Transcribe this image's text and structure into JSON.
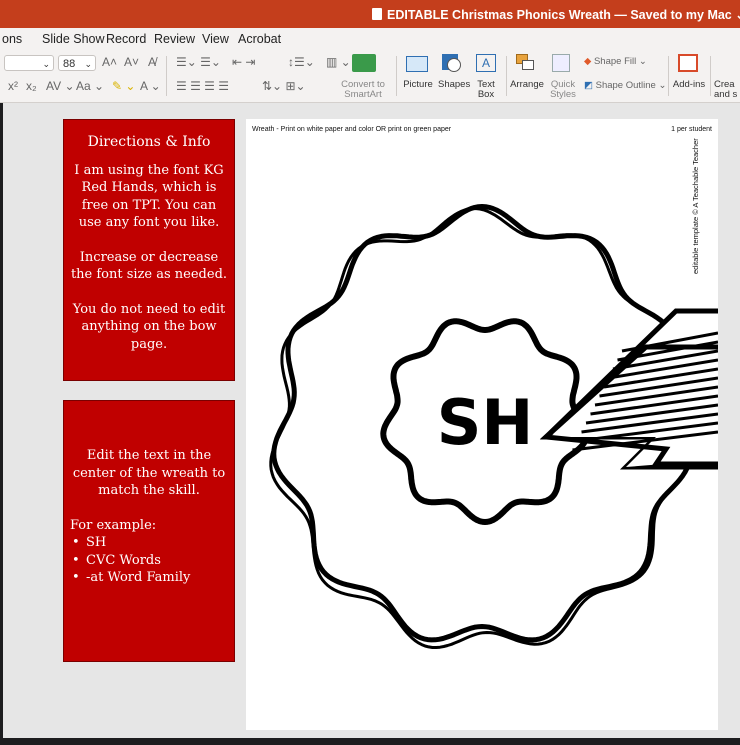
{
  "title_bar": {
    "title": "EDITABLE Christmas Phonics Wreath — Saved to my Mac ⌄"
  },
  "menu": [
    "ons",
    "Slide Show",
    "Record",
    "Review",
    "View",
    "Acrobat"
  ],
  "ribbon": {
    "font_size": "88",
    "convert_to_smartart": [
      "Convert to",
      "SmartArt"
    ],
    "picture": "Picture",
    "shapes": "Shapes",
    "text_box": [
      "Text",
      "Box"
    ],
    "arrange": "Arrange",
    "quick_styles": [
      "Quick",
      "Styles"
    ],
    "shape_fill": "Shape Fill",
    "shape_outline": "Shape Outline",
    "add_ins": "Add-ins",
    "create_share": [
      "Crea",
      "and s"
    ]
  },
  "notes": {
    "directions": {
      "heading": "Directions & Info",
      "p1": "I am using the font KG Red Hands, which is free on TPT. You can use any font you like.",
      "p2": "Increase or decrease the font size as needed.",
      "p3": "You do not need to edit anything on the bow page."
    },
    "edit": {
      "p1": "Edit the text in the center of the wreath to match the skill.",
      "example": "For example:",
      "items": [
        "SH",
        "CVC Words",
        "-at Word Family"
      ]
    }
  },
  "page": {
    "header_left": "Wreath - Print on white paper and color OR print on green paper",
    "header_right": "1 per student",
    "vertical_text": "editable template © A Teachable Teacher",
    "center_text": "SH"
  }
}
